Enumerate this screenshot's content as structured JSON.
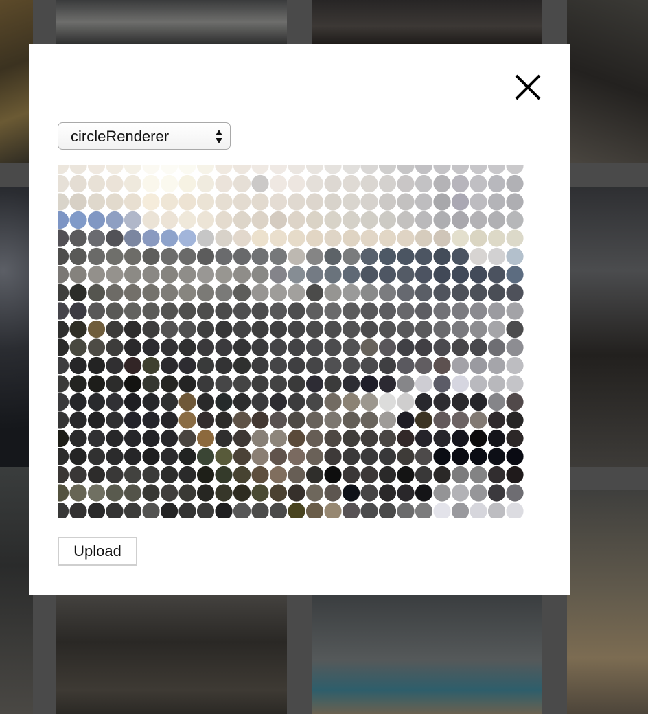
{
  "modal": {
    "renderer_select": {
      "selected": "circleRenderer"
    },
    "upload_label": "Upload"
  },
  "colors": {
    "modal_bg": "#ffffff",
    "dim_overlay": "#4a4a4a"
  },
  "icons": {
    "close": "close-icon",
    "select_arrows": "select-arrows-icon"
  },
  "mosaic": {
    "renderer": "circle",
    "rows": [
      [
        "#ece6dd",
        "#ebe5dc",
        "#efe8df",
        "#f1ebe1",
        "#f4f0e6",
        "#fbf9f2",
        "#fcfbf5",
        "#fbfaf2",
        "#f6f3e8",
        "#f0e9e0",
        "#ede6de",
        "#efe9e3",
        "#efe9e4",
        "#ebe6e1",
        "#e8e4df",
        "#e5e2de",
        "#e1dfdc",
        "#d9d7d5",
        "#cfcecd",
        "#c6c5c6",
        "#c1c0c3",
        "#c4c3c6",
        "#c5c4c7",
        "#c7c6c9",
        "#c8c7ca",
        "#cac9cb"
      ],
      [
        "#e6e0d7",
        "#e4ddd3",
        "#e8e1d6",
        "#ebe3d8",
        "#efe9dd",
        "#faf7ec",
        "#fbf9ef",
        "#f6f2e3",
        "#f0ebdf",
        "#ebe3da",
        "#e6dfd6",
        "#cbc9c8",
        "#efe8e2",
        "#ede6e0",
        "#e4dfd9",
        "#ddd8d2",
        "#dfdad4",
        "#dad6d1",
        "#d4d1ce",
        "#c9c6c6",
        "#c3c2c4",
        "#b4b3b6",
        "#b7b5bc",
        "#c0bfc3",
        "#b8b8bd",
        "#b1b1b5"
      ],
      [
        "#d9d4ca",
        "#d7d0c5",
        "#dfd8cc",
        "#e2dacd",
        "#e8dfd1",
        "#f5ecdb",
        "#efe6d6",
        "#ede3d3",
        "#ebe3d5",
        "#e6ded2",
        "#e3dbd0",
        "#e2dacf",
        "#e4dcd3",
        "#e0d9d0",
        "#ddd6cd",
        "#d8d3cb",
        "#d9d5ce",
        "#d6d2cd",
        "#ccc9c6",
        "#c3c1c0",
        "#bebdbf",
        "#a8a8ab",
        "#aaa8b3",
        "#bdbcc0",
        "#b4b4b8",
        "#aeaeb2"
      ],
      [
        "#7d95c4",
        "#809ac8",
        "#8097c3",
        "#8e9fc2",
        "#b0b7c9",
        "#ebe3d6",
        "#ece3d6",
        "#efe8da",
        "#ece4d6",
        "#e4dbce",
        "#ddd5c9",
        "#dcd3c7",
        "#d4cbc0",
        "#ddd4c8",
        "#dad3c6",
        "#d8d3c8",
        "#d5d1c8",
        "#d1cec6",
        "#cccac4",
        "#c3c1bf",
        "#bab9bb",
        "#aeaeb1",
        "#a9a8ad",
        "#b3b2b5",
        "#b0b0b3",
        "#b6b7b9"
      ],
      [
        "#525055",
        "#5b5a5c",
        "#6a6b70",
        "#525257",
        "#7b86a0",
        "#8a9ac0",
        "#8ea3cb",
        "#a2b5da",
        "#c6c6c6",
        "#d8d2c9",
        "#e2d8cc",
        "#ece1cd",
        "#eadfcd",
        "#e6dbc9",
        "#e2d6c4",
        "#dfd5c6",
        "#dfd4c3",
        "#e1d6c6",
        "#e2d7c6",
        "#dfd4c4",
        "#d6ccbd",
        "#cfc5b8",
        "#e3dfcd",
        "#dad5c2",
        "#ddd9c7",
        "#dcd9c9"
      ],
      [
        "#4e4d4c",
        "#595957",
        "#6a6a68",
        "#6f6f6b",
        "#6d6c68",
        "#5e5e5c",
        "#6c6c6b",
        "#6a6a69",
        "#5c5c5c",
        "#6a6b6d",
        "#68696b",
        "#707274",
        "#76787a",
        "#bdb8b1",
        "#858585",
        "#5d6368",
        "#7a7c7d",
        "#58616d",
        "#4d5865",
        "#4b5562",
        "#4c5562",
        "#434c59",
        "#4a5361",
        "#d7d4d2",
        "#d2d1d2",
        "#b3c0cc"
      ],
      [
        "#7a7774",
        "#85827d",
        "#93908b",
        "#95928d",
        "#8c8a85",
        "#8a8884",
        "#86847f",
        "#8f8d89",
        "#999794",
        "#989691",
        "#8f8d89",
        "#898986",
        "#84848a",
        "#868d94",
        "#747b84",
        "#6a737c",
        "#5f6975",
        "#4d5561",
        "#4e5663",
        "#545b66",
        "#4c5361",
        "#414957",
        "#404958",
        "#424a59",
        "#4b525f",
        "#5c6c80"
      ],
      [
        "#3e3e3c",
        "#2b2c28",
        "#55554f",
        "#6d6b66",
        "#73706a",
        "#74726c",
        "#7e7c77",
        "#87857f",
        "#7b7a76",
        "#7a7a78",
        "#5d5d5a",
        "#979592",
        "#9e9c99",
        "#a2a09d",
        "#4b4b4a",
        "#969592",
        "#9a9a99",
        "#898a8a",
        "#7b7c7f",
        "#666970",
        "#5a5e66",
        "#50545d",
        "#4d5159",
        "#4c5058",
        "#4a4e56",
        "#4e515a"
      ],
      [
        "#45444a",
        "#3c3b42",
        "#595858",
        "#595956",
        "#62625f",
        "#5b5b58",
        "#535351",
        "#4f4f4d",
        "#4d4d4c",
        "#4a4a4a",
        "#4f4f50",
        "#4c4c4d",
        "#575758",
        "#4d4d4e",
        "#5e5e5f",
        "#6a6a6b",
        "#5c5c5d",
        "#58585a",
        "#5c5c60",
        "#67676b",
        "#5e5e63",
        "#717176",
        "#7b7b80",
        "#8a8a8f",
        "#9b9ba0",
        "#a3a3a7"
      ],
      [
        "#2f2f2e",
        "#2f2e25",
        "#6f5d3c",
        "#3c3b39",
        "#2d2c2c",
        "#3e3d3d",
        "#545353",
        "#4f4f4f",
        "#3f3f3f",
        "#363637",
        "#434344",
        "#3e3e3e",
        "#3f3f40",
        "#444445",
        "#4a4a4b",
        "#4d4d4e",
        "#525253",
        "#4b4b4c",
        "#525253",
        "#58585a",
        "#5a5a5c",
        "#6a6a6d",
        "#7a7a7e",
        "#8d8d90",
        "#a5a5a8",
        "#4c4c4d"
      ],
      [
        "#2b2b2a",
        "#48483f",
        "#4d4b45",
        "#3d3c3b",
        "#2a292b",
        "#2c2c30",
        "#333235",
        "#2f2f30",
        "#3a393b",
        "#3b3a3d",
        "#333335",
        "#3b3b3d",
        "#444446",
        "#434345",
        "#4a4a4c",
        "#4c4c4e",
        "#525253",
        "#67625b",
        "#59565a",
        "#404045",
        "#413f44",
        "#4b4a4f",
        "#474649",
        "#48484c",
        "#6e6e73",
        "#8d8d92"
      ],
      [
        "#3d3d3f",
        "#262628",
        "#232323",
        "#302f31",
        "#322526",
        "#3f402f",
        "#2b2a2e",
        "#2d2c31",
        "#393a3a",
        "#333334",
        "#2f302f",
        "#3c3c3e",
        "#454547",
        "#3f3f41",
        "#454547",
        "#505052",
        "#4d4d4f",
        "#4b4b4d",
        "#3f3f42",
        "#5a595f",
        "#615d61",
        "#5d5150",
        "#a3a2a8",
        "#9a9aa0",
        "#a5a5aa",
        "#bdbdc1"
      ],
      [
        "#3a3a39",
        "#232421",
        "#1d1d1a",
        "#2c2c2b",
        "#141412",
        "#353730",
        "#252522",
        "#242424",
        "#3a3a3b",
        "#464647",
        "#444444",
        "#3e3e3e",
        "#434343",
        "#3a3a3a",
        "#2d2c34",
        "#3b3b3b",
        "#2d2d33",
        "#1f1e29",
        "#2c2a32",
        "#868689",
        "#cecdd3",
        "#5c5c67",
        "#d6d6e0",
        "#b9b9be",
        "#b8b8bc",
        "#c4c4c8"
      ],
      [
        "#3a3a3c",
        "#252629",
        "#292a2d",
        "#303034",
        "#1e1e22",
        "#26272a",
        "#2f3030",
        "#6f5838",
        "#29292a",
        "#252a2b",
        "#2c2c2d",
        "#3a3a3c",
        "#2d2c31",
        "#3c3c3d",
        "#484848",
        "#726b62",
        "#8b8274",
        "#9c978e",
        "#dcdcdb",
        "#cfcece",
        "#28282d",
        "#2d2c30",
        "#2a292c",
        "#252529",
        "#858589",
        "#51494a"
      ],
      [
        "#353535",
        "#28282a",
        "#222224",
        "#303032",
        "#23232a",
        "#25252b",
        "#27262a",
        "#8a6c44",
        "#332d2e",
        "#2d2b29",
        "#5e5246",
        "#433832",
        "#595251",
        "#4e4a45",
        "#68625b",
        "#7c7770",
        "#635e57",
        "#69645d",
        "#9e9b98",
        "#1d1c24",
        "#3c3423",
        "#62595a",
        "#6c6363",
        "#827a73",
        "#2f2a2c",
        "#272626"
      ],
      [
        "#1d1d17",
        "#2a2a2b",
        "#303032",
        "#272729",
        "#26262a",
        "#232327",
        "#26262a",
        "#49443f",
        "#8c693d",
        "#2f2e2e",
        "#3d3734",
        "#888077",
        "#8d857b",
        "#5a4a3a",
        "#665d55",
        "#4e4843",
        "#3f3d3a",
        "#403d3b",
        "#4a4643",
        "#322828",
        "#25232a",
        "#27262b",
        "#15151d",
        "#0d0b0c",
        "#14141a",
        "#2c2727"
      ],
      [
        "#2d2d2c",
        "#242424",
        "#313131",
        "#2b2b2c",
        "#262628",
        "#1f1f20",
        "#2b2b2e",
        "#212322",
        "#3a4534",
        "#585a3a",
        "#4b4237",
        "#8b7f74",
        "#60534c",
        "#7a6a60",
        "#6a6158",
        "#3e3a39",
        "#3a3939",
        "#3a3a3b",
        "#383839",
        "#3e3b38",
        "#4d4a4a",
        "#0b0d14",
        "#0b0c13",
        "#0a0c14",
        "#0d0f16",
        "#0a0b13"
      ],
      [
        "#3a3735",
        "#393736",
        "#2d2c2b",
        "#393837",
        "#42423f",
        "#3b3b39",
        "#2d2d2c",
        "#2a2a2a",
        "#1e1f18",
        "#343a2a",
        "#474331",
        "#5e4f3e",
        "#806e5e",
        "#675e55",
        "#2f2e2b",
        "#0e0e0e",
        "#3a3737",
        "#3c3837",
        "#2a2929",
        "#141414",
        "#393838",
        "#2a2827",
        "#7c7c7d",
        "#838384",
        "#312d2f",
        "#1f1a1b"
      ],
      [
        "#53523f",
        "#676554",
        "#707062",
        "#595a4e",
        "#535349",
        "#383834",
        "#403e3c",
        "#3a3935",
        "#262622",
        "#363629",
        "#2e2c20",
        "#4a4a33",
        "#4b4131",
        "#36302b",
        "#6e675c",
        "#5d5650",
        "#0e1118",
        "#464444",
        "#2a2829",
        "#29272a",
        "#141417",
        "#949496",
        "#b2b2b6",
        "#969699",
        "#3b393d",
        "#6e6d72"
      ],
      [
        "#383837",
        "#333231",
        "#2a2a2a",
        "#343433",
        "#3c3c3a",
        "#535351",
        "#242424",
        "#343433",
        "#3b3b3a",
        "#1f1f20",
        "#575757",
        "#4c4c4b",
        "#4a4a49",
        "#48431f",
        "#6a5d49",
        "#968771",
        "#575254",
        "#4b4b4c",
        "#4a4a4a",
        "#6b6b6c",
        "#7c7c7d",
        "#e3e3ea",
        "#99999d",
        "#d6d6dc",
        "#bdbdc1",
        "#dcdce1"
      ]
    ]
  }
}
